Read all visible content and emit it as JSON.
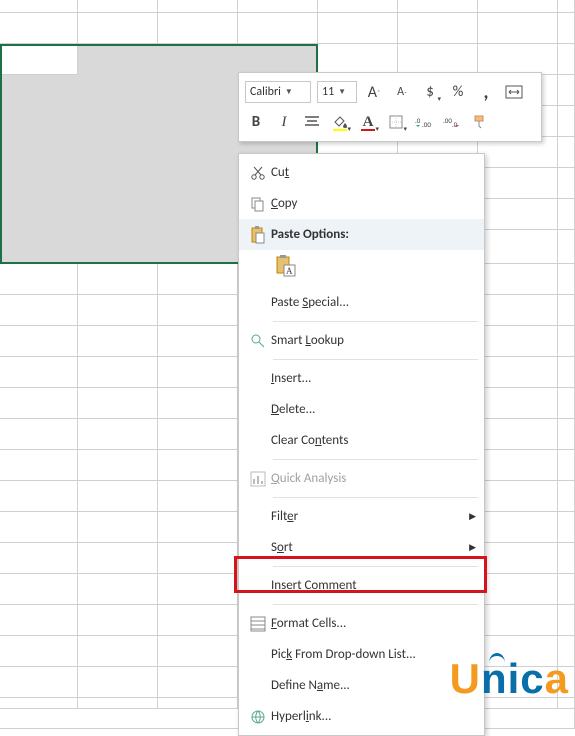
{
  "mini": {
    "font_name": "Calibri",
    "font_size": "11",
    "increase_font": "A",
    "decrease_font": "A",
    "currency": "$",
    "percent": "%",
    "comma": ","
  },
  "ctx": {
    "cut": "Cut",
    "copy": "Copy",
    "paste_options": "Paste Options:",
    "paste_special": "Paste Special...",
    "smart_lookup": "Smart Lookup",
    "insert": "Insert...",
    "delete": "Delete...",
    "clear_contents": "Clear Contents",
    "quick_analysis": "Quick Analysis",
    "filter": "Filter",
    "sort": "Sort",
    "insert_comment": "Insert Comment",
    "format_cells": "Format Cells...",
    "pick_dropdown": "Pick From Drop-down List...",
    "define_name": "Define Name...",
    "hyperlink": "Hyperlink..."
  },
  "logo": {
    "text_u": "U",
    "text_nic": "nic",
    "text_a": "a"
  }
}
